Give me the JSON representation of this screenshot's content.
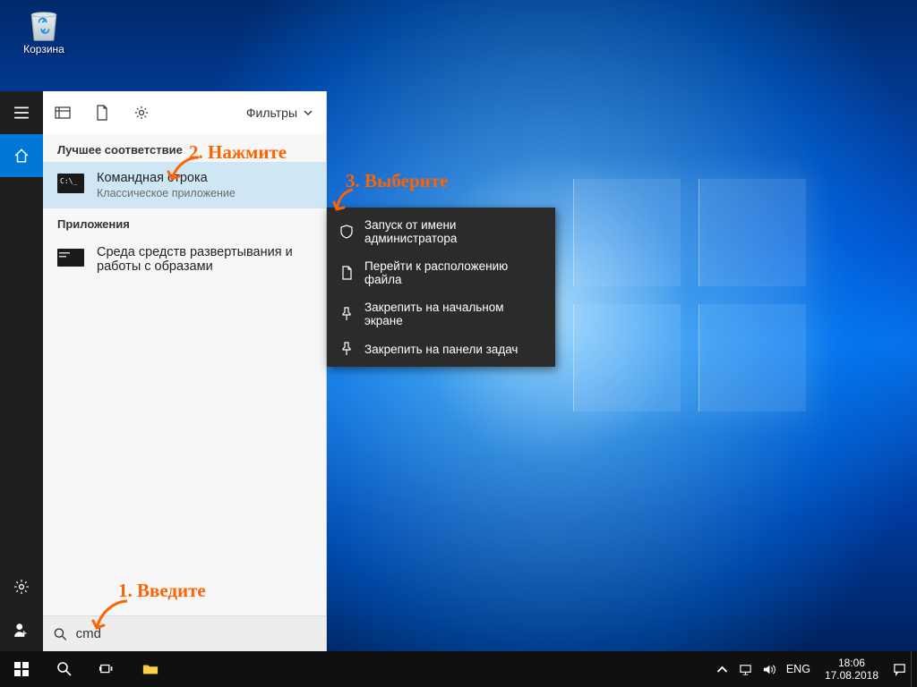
{
  "desktop": {
    "recycle_bin_label": "Корзина"
  },
  "start_rail": {
    "items": [
      "menu-icon",
      "home-icon",
      "settings-icon",
      "user-icon"
    ]
  },
  "search_panel": {
    "top_icons": [
      "apps-icon",
      "document-icon",
      "gear-icon"
    ],
    "filters_label": "Фильтры",
    "section_best": "Лучшее соответствие",
    "result_main": {
      "title": "Командная строка",
      "subtitle": "Классическое приложение"
    },
    "section_apps": "Приложения",
    "result_secondary": {
      "title": "Среда средств развертывания и работы с образами"
    },
    "search_value": "cmd"
  },
  "context_menu": {
    "items": [
      "Запуск от имени администратора",
      "Перейти к расположению файла",
      "Закрепить на начальном экране",
      "Закрепить на панели задач"
    ]
  },
  "taskbar": {
    "language": "ENG",
    "time": "18:06",
    "date": "17.08.2018"
  },
  "annotations": {
    "step1": "1. Введите",
    "step2": "2. Нажмите",
    "step3": "3. Выберите"
  },
  "colors": {
    "annotation": "#ff6200",
    "accent": "#0078d7"
  }
}
